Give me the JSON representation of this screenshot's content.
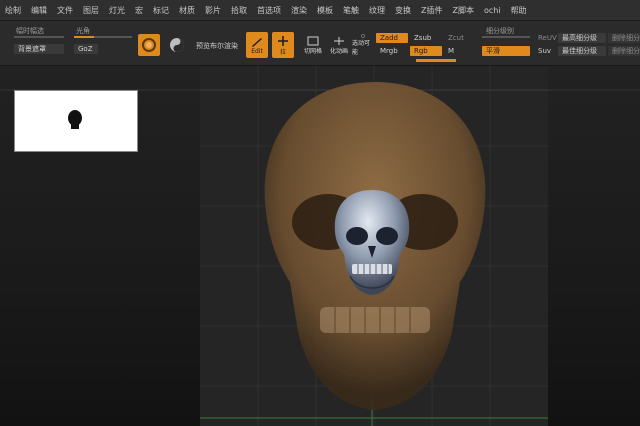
{
  "menu": [
    "绘制",
    "编辑",
    "文件",
    "图层",
    "灯光",
    "宏",
    "标记",
    "材质",
    "影片",
    "拾取",
    "首选项",
    "渲染",
    "模板",
    "笔触",
    "纹理",
    "变换",
    "Z插件",
    "Z脚本",
    "ochi",
    "帮助"
  ],
  "toolbar": {
    "left_label": "幅时幅选",
    "left_button": "背景遮罩",
    "color_label": "光角",
    "goz_button": "GoZ",
    "preview_label": "预览布尔渲染",
    "edit_label": "Edit",
    "move_label": "拉",
    "scale_label": "移",
    "btn4_label": "切网格",
    "btn5_label": "化动画",
    "btn6_label": "选动可能",
    "zadd": "Zadd",
    "zsub": "Zsub",
    "zcut": "Zcut",
    "mrgb": "Mrgb",
    "rgb": "Rgb",
    "m": "M",
    "smooth_label": "细分级别",
    "smooth_button": "平滑",
    "reuv": "ReUV",
    "suv": "Suv",
    "btn_hi1": "最高细分级",
    "btn_hi2": "最佳细分级",
    "btn_del1": "删除细分",
    "btn_del2": "删除细分"
  },
  "colors": {
    "accent": "#e08a1e",
    "menubar": "#2f2f2f",
    "toolbar": "#2b2b2b",
    "skull_brown": "#7a5a38",
    "skull_blue": "#9aa6b8"
  },
  "icons": [
    "edit-icon",
    "move-icon",
    "scale-icon",
    "mesh-icon",
    "anim-icon",
    "select-icon",
    "material-sphere-icon",
    "yin-yang-icon"
  ]
}
